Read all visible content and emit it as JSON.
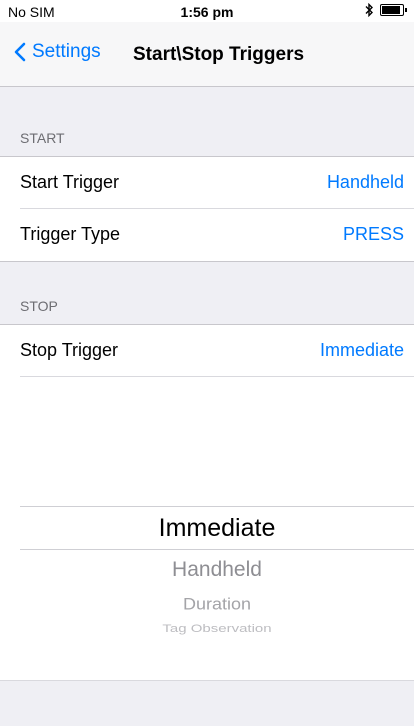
{
  "status": {
    "carrier": "No SIM",
    "time": "1:56 pm",
    "bluetooth_icon": "bluetooth-icon",
    "battery_icon": "battery-icon"
  },
  "nav": {
    "back_label": "Settings",
    "title": "Start\\Stop Triggers"
  },
  "sections": {
    "start": {
      "header": "START",
      "rows": [
        {
          "label": "Start Trigger",
          "value": "Handheld"
        },
        {
          "label": "Trigger Type",
          "value": "PRESS"
        }
      ]
    },
    "stop": {
      "header": "STOP",
      "rows": [
        {
          "label": "Stop Trigger",
          "value": "Immediate"
        }
      ]
    }
  },
  "picker": {
    "options": [
      "Immediate",
      "Handheld",
      "Duration",
      "Tag Observation"
    ],
    "selected": "Immediate"
  },
  "colors": {
    "accent": "#007aff",
    "group_bg": "#efeff4",
    "header_text": "#6d6d72"
  }
}
